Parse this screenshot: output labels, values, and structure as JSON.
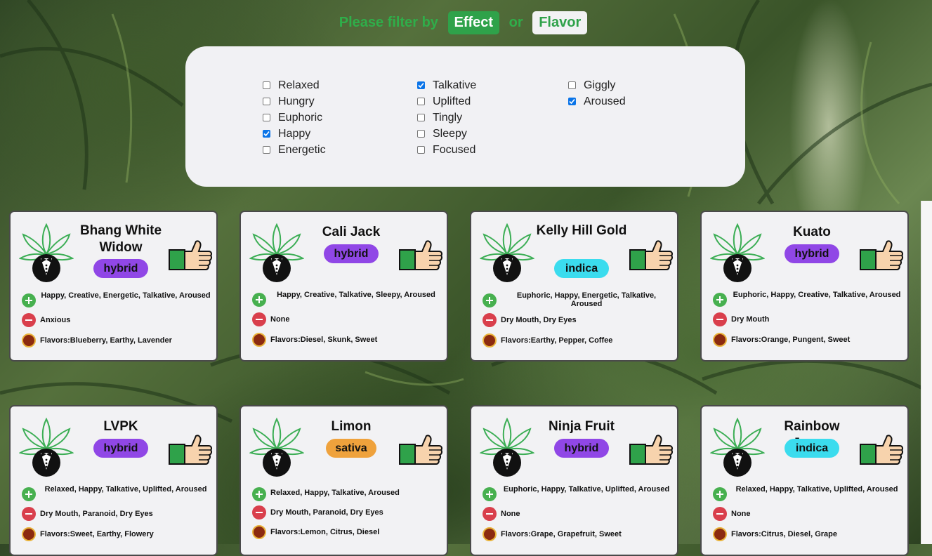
{
  "header": {
    "prefix": "Please filter by",
    "effect_label": "Effect",
    "or_label": "or",
    "flavor_label": "Flavor"
  },
  "filters": [
    {
      "label": "Relaxed",
      "checked": false
    },
    {
      "label": "Hungry",
      "checked": false
    },
    {
      "label": "Euphoric",
      "checked": false
    },
    {
      "label": "Happy",
      "checked": true
    },
    {
      "label": "Energetic",
      "checked": false
    },
    {
      "label": "Talkative",
      "checked": true
    },
    {
      "label": "Uplifted",
      "checked": false
    },
    {
      "label": "Tingly",
      "checked": false
    },
    {
      "label": "Sleepy",
      "checked": false
    },
    {
      "label": "Focused",
      "checked": false
    },
    {
      "label": "Giggly",
      "checked": false
    },
    {
      "label": "Aroused",
      "checked": true
    }
  ],
  "cards": [
    {
      "name": "Bhang White Widow",
      "type": "hybrid",
      "positive": "Happy, Creative, Energetic, Talkative, Aroused",
      "negative": "Anxious",
      "flavors": "Flavors:Blueberry, Earthy, Lavender"
    },
    {
      "name": "Cali Jack",
      "type": "hybrid",
      "positive": "Happy, Creative, Talkative, Sleepy, Aroused",
      "negative": "None",
      "flavors": "Flavors:Diesel, Skunk, Sweet"
    },
    {
      "name": "Kelly Hill Gold",
      "type": "indica",
      "positive": "Euphoric, Happy, Energetic, Talkative, Aroused",
      "negative": "Dry Mouth, Dry Eyes",
      "flavors": "Flavors:Earthy, Pepper, Coffee"
    },
    {
      "name": "Kuato",
      "type": "hybrid",
      "positive": "Euphoric, Happy, Creative, Talkative, Aroused",
      "negative": "Dry Mouth",
      "flavors": "Flavors:Orange, Pungent, Sweet"
    },
    {
      "name": "LVPK",
      "type": "hybrid",
      "positive": "Relaxed, Happy, Talkative, Uplifted, Aroused",
      "negative": "Dry Mouth, Paranoid, Dry Eyes",
      "flavors": "Flavors:Sweet, Earthy, Flowery"
    },
    {
      "name": "Limon",
      "type": "sativa",
      "positive": "Relaxed, Happy, Talkative, Aroused",
      "negative": "Dry Mouth, Paranoid, Dry Eyes",
      "flavors": "Flavors:Lemon, Citrus, Diesel"
    },
    {
      "name": "Ninja Fruit",
      "type": "hybrid",
      "positive": "Euphoric, Happy, Talkative, Uplifted, Aroused",
      "negative": "None",
      "flavors": "Flavors:Grape, Grapefruit, Sweet"
    },
    {
      "name": "Rainbow Jones",
      "type": "indica",
      "positive": "Relaxed, Happy, Talkative, Uplifted, Aroused",
      "negative": "None",
      "flavors": "Flavors:Citrus, Diesel, Grape"
    }
  ]
}
